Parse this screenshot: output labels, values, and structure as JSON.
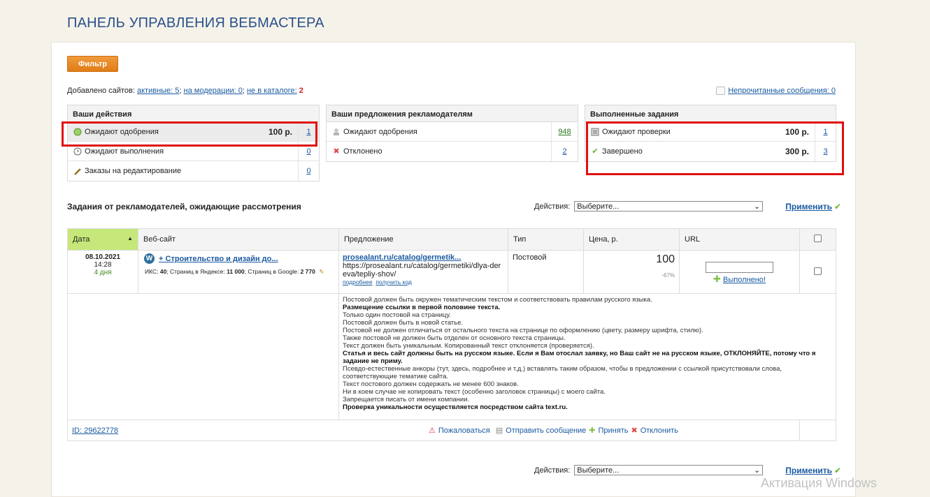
{
  "page_title": "ПАНЕЛЬ УПРАВЛЕНИЯ ВЕБМАСТЕРА",
  "filter_label": "Фильтр",
  "sites": {
    "prefix": "Добавлено сайтов:",
    "active_label": "активные: 5",
    "moderation_label": "на модерации: 0",
    "not_in_catalog_label": "не в каталоге:",
    "not_in_catalog_count": "2",
    "sep": ";"
  },
  "unread_messages": "Непрочитанные сообщения: 0",
  "your_actions": {
    "title": "Ваши действия",
    "rows": [
      {
        "label": "Ожидают одобрения",
        "amount": "100 р.",
        "count": "1"
      },
      {
        "label": "Ожидают выполнения",
        "amount": "",
        "count": "0"
      },
      {
        "label": "Заказы на редактирование",
        "amount": "",
        "count": "0"
      }
    ]
  },
  "offers": {
    "title": "Ваши предложения рекламодателям",
    "rows": [
      {
        "label": "Ожидают одобрения",
        "count": "948"
      },
      {
        "label": "Отклонено",
        "count": "2"
      }
    ]
  },
  "completed": {
    "title": "Выполненные задания",
    "rows": [
      {
        "label": "Ожидают проверки",
        "amount": "100 р.",
        "count": "1"
      },
      {
        "label": "Завершено",
        "amount": "300 р.",
        "count": "3"
      }
    ]
  },
  "tasks_title": "Задания от рекламодателей, ожидающие рассмотрения",
  "actions_label": "Действия:",
  "actions_select": "Выберите...",
  "apply_label": "Применить",
  "table": {
    "headers": [
      "Дата",
      "Веб-сайт",
      "Предложение",
      "Тип",
      "Цена, р.",
      "URL"
    ],
    "row": {
      "date": "08.10.2021",
      "time": "14:28",
      "days": "4 дня",
      "site_plus": "+",
      "site_name": "Строительство и дизайн до...",
      "site_stats_iks_label": "ИКС:",
      "site_stats_iks": "40",
      "site_stats_yandex_label": "; Страниц в Яндексе:",
      "site_stats_yandex": "11 000",
      "site_stats_google_label": "; Страниц в Google:",
      "site_stats_google": "2 770",
      "offer_link": "prosealant.ru/catalog/germetik...",
      "offer_url": "https://prosealant.ru/catalog/germetiki/dlya-dereva/tepliy-shov/",
      "offer_more": "подробнее",
      "offer_code": "получить код",
      "type": "Постовой",
      "price": "100",
      "discount": "-67%",
      "done_label": "Выполнено!",
      "id_label": "ID: 29622778",
      "complain": "Пожаловаться",
      "send_message": "Отправить сообщение",
      "accept": "Принять",
      "reject": "Отклонить"
    },
    "description": [
      {
        "text": "Постовой должен быть окружен тематическим текстом и соответствовать правилам русского языка.",
        "bold": false
      },
      {
        "text": "Размещение ссылки в первой половине текста.",
        "bold": true
      },
      {
        "text": "Только один постовой на страницу.",
        "bold": false
      },
      {
        "text": "Постовой должен быть в новой статье.",
        "bold": false
      },
      {
        "text": "Постовой не должен отличаться от остального текста на странице по оформлению (цвету, размеру шрифта, стилю).",
        "bold": false
      },
      {
        "text": "Также постовой не должен быть отделен от основного текста страницы.",
        "bold": false
      },
      {
        "text": "Текст должен быть уникальным. Копированный текст отклоняется (проверяется).",
        "bold": false
      },
      {
        "text": "Статья и весь сайт должны быть на русском языке. Если я Вам отослал заявку, но Ваш сайт не на русском языке, ОТКЛОНЯЙТЕ, потому что я задание не приму.",
        "bold": true
      },
      {
        "text": "Псевдо-естественные анкоры (тут, здесь, подробнее и т.д.) вставлять таким образом, чтобы в предложении с ссылкой присутствовали слова, соответствующие тематике сайта.",
        "bold": false
      },
      {
        "text": "Текст постового должен содержать не менее 600 знаков.",
        "bold": false
      },
      {
        "text": "Ни в коем случае не копировать текст (особенно заголовок страницы) с моего сайта.",
        "bold": false
      },
      {
        "text": "Запрещается писать от имени компании.",
        "bold": false
      },
      {
        "text": "Проверка уникальности осуществляется посредством сайта text.ru.",
        "bold": true
      }
    ]
  },
  "watermark": "Активация Windows",
  "colors": {
    "accent": "#2b4f8c",
    "orange": "#e88a26",
    "red": "#e01010",
    "green": "#62b32e",
    "link": "#1a5aa0"
  }
}
